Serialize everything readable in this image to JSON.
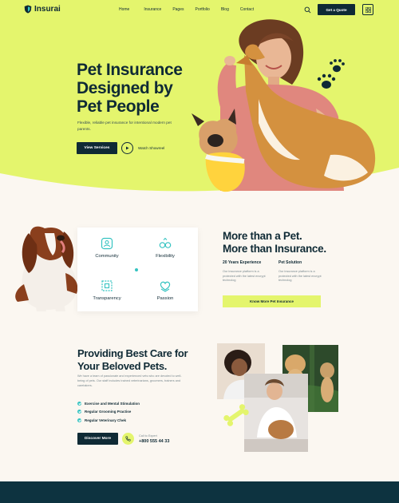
{
  "brand": {
    "name": "Insurai"
  },
  "nav": {
    "items": [
      "Home",
      "Insurance",
      "Pages",
      "Portfolio",
      "Blog",
      "Contact"
    ],
    "cta": "Get a Quote"
  },
  "hero": {
    "title_lines": [
      "Pet Insurance",
      "Designed by",
      "Pet People"
    ],
    "description": "Flexible, reliable pet insurance for intentional modern pet parents.",
    "primary_button": "View Services",
    "video_label": "Watch Showreel"
  },
  "features": {
    "items": [
      {
        "label": "Community",
        "icon": "community-icon"
      },
      {
        "label": "Flexibility",
        "icon": "flexibility-icon"
      },
      {
        "label": "Transparency",
        "icon": "transparency-icon"
      },
      {
        "label": "Passion",
        "icon": "passion-icon"
      }
    ]
  },
  "about": {
    "title_lines": [
      "More than a Pet.",
      "More than Insurance."
    ],
    "col1": {
      "heading": "20 Years Experience",
      "text": "Our insurance platform is a protected with the latest encrypt technolog"
    },
    "col2": {
      "heading": "Pet Solution",
      "text": "Our insurance platform is a protected with the latest encrypt technolog"
    },
    "button": "Know More Pet Insurance"
  },
  "care": {
    "title_lines": [
      "Providing Best Care for",
      "Your Beloved Pets."
    ],
    "description": "We have a team of passionate and experienced vets who are devoted to well-being of pets. Our staff includes trained veterinarians, groomers, trainers and caretakers.",
    "checks": [
      "Exercise and Mental Stimulation",
      "Regular Grooming Practise",
      "Regular Veterinary Chek"
    ],
    "button": "Discover More",
    "call_label": "Call to Expert",
    "phone": "+800 555 44 33"
  },
  "colors": {
    "lime": "#e4f56d",
    "navy": "#0f2a35",
    "teal": "#35c3c1",
    "cream": "#fbf7f1",
    "footer": "#0d3340"
  }
}
